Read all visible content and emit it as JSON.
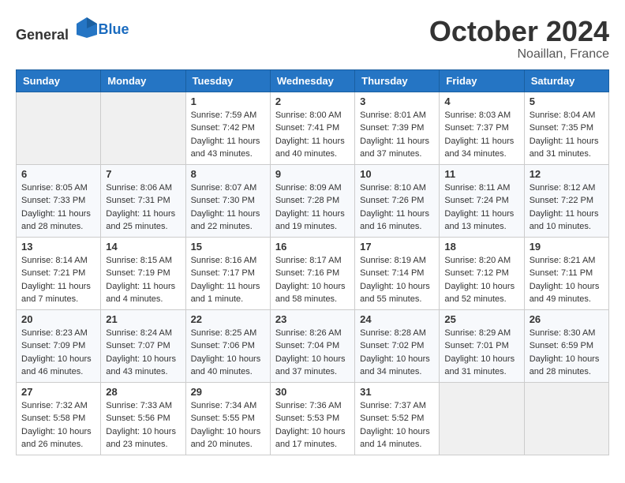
{
  "header": {
    "logo_general": "General",
    "logo_blue": "Blue",
    "month": "October 2024",
    "location": "Noaillan, France"
  },
  "days_of_week": [
    "Sunday",
    "Monday",
    "Tuesday",
    "Wednesday",
    "Thursday",
    "Friday",
    "Saturday"
  ],
  "weeks": [
    [
      {
        "day": "",
        "content": ""
      },
      {
        "day": "",
        "content": ""
      },
      {
        "day": "1",
        "content": "Sunrise: 7:59 AM\nSunset: 7:42 PM\nDaylight: 11 hours and 43 minutes."
      },
      {
        "day": "2",
        "content": "Sunrise: 8:00 AM\nSunset: 7:41 PM\nDaylight: 11 hours and 40 minutes."
      },
      {
        "day": "3",
        "content": "Sunrise: 8:01 AM\nSunset: 7:39 PM\nDaylight: 11 hours and 37 minutes."
      },
      {
        "day": "4",
        "content": "Sunrise: 8:03 AM\nSunset: 7:37 PM\nDaylight: 11 hours and 34 minutes."
      },
      {
        "day": "5",
        "content": "Sunrise: 8:04 AM\nSunset: 7:35 PM\nDaylight: 11 hours and 31 minutes."
      }
    ],
    [
      {
        "day": "6",
        "content": "Sunrise: 8:05 AM\nSunset: 7:33 PM\nDaylight: 11 hours and 28 minutes."
      },
      {
        "day": "7",
        "content": "Sunrise: 8:06 AM\nSunset: 7:31 PM\nDaylight: 11 hours and 25 minutes."
      },
      {
        "day": "8",
        "content": "Sunrise: 8:07 AM\nSunset: 7:30 PM\nDaylight: 11 hours and 22 minutes."
      },
      {
        "day": "9",
        "content": "Sunrise: 8:09 AM\nSunset: 7:28 PM\nDaylight: 11 hours and 19 minutes."
      },
      {
        "day": "10",
        "content": "Sunrise: 8:10 AM\nSunset: 7:26 PM\nDaylight: 11 hours and 16 minutes."
      },
      {
        "day": "11",
        "content": "Sunrise: 8:11 AM\nSunset: 7:24 PM\nDaylight: 11 hours and 13 minutes."
      },
      {
        "day": "12",
        "content": "Sunrise: 8:12 AM\nSunset: 7:22 PM\nDaylight: 11 hours and 10 minutes."
      }
    ],
    [
      {
        "day": "13",
        "content": "Sunrise: 8:14 AM\nSunset: 7:21 PM\nDaylight: 11 hours and 7 minutes."
      },
      {
        "day": "14",
        "content": "Sunrise: 8:15 AM\nSunset: 7:19 PM\nDaylight: 11 hours and 4 minutes."
      },
      {
        "day": "15",
        "content": "Sunrise: 8:16 AM\nSunset: 7:17 PM\nDaylight: 11 hours and 1 minute."
      },
      {
        "day": "16",
        "content": "Sunrise: 8:17 AM\nSunset: 7:16 PM\nDaylight: 10 hours and 58 minutes."
      },
      {
        "day": "17",
        "content": "Sunrise: 8:19 AM\nSunset: 7:14 PM\nDaylight: 10 hours and 55 minutes."
      },
      {
        "day": "18",
        "content": "Sunrise: 8:20 AM\nSunset: 7:12 PM\nDaylight: 10 hours and 52 minutes."
      },
      {
        "day": "19",
        "content": "Sunrise: 8:21 AM\nSunset: 7:11 PM\nDaylight: 10 hours and 49 minutes."
      }
    ],
    [
      {
        "day": "20",
        "content": "Sunrise: 8:23 AM\nSunset: 7:09 PM\nDaylight: 10 hours and 46 minutes."
      },
      {
        "day": "21",
        "content": "Sunrise: 8:24 AM\nSunset: 7:07 PM\nDaylight: 10 hours and 43 minutes."
      },
      {
        "day": "22",
        "content": "Sunrise: 8:25 AM\nSunset: 7:06 PM\nDaylight: 10 hours and 40 minutes."
      },
      {
        "day": "23",
        "content": "Sunrise: 8:26 AM\nSunset: 7:04 PM\nDaylight: 10 hours and 37 minutes."
      },
      {
        "day": "24",
        "content": "Sunrise: 8:28 AM\nSunset: 7:02 PM\nDaylight: 10 hours and 34 minutes."
      },
      {
        "day": "25",
        "content": "Sunrise: 8:29 AM\nSunset: 7:01 PM\nDaylight: 10 hours and 31 minutes."
      },
      {
        "day": "26",
        "content": "Sunrise: 8:30 AM\nSunset: 6:59 PM\nDaylight: 10 hours and 28 minutes."
      }
    ],
    [
      {
        "day": "27",
        "content": "Sunrise: 7:32 AM\nSunset: 5:58 PM\nDaylight: 10 hours and 26 minutes."
      },
      {
        "day": "28",
        "content": "Sunrise: 7:33 AM\nSunset: 5:56 PM\nDaylight: 10 hours and 23 minutes."
      },
      {
        "day": "29",
        "content": "Sunrise: 7:34 AM\nSunset: 5:55 PM\nDaylight: 10 hours and 20 minutes."
      },
      {
        "day": "30",
        "content": "Sunrise: 7:36 AM\nSunset: 5:53 PM\nDaylight: 10 hours and 17 minutes."
      },
      {
        "day": "31",
        "content": "Sunrise: 7:37 AM\nSunset: 5:52 PM\nDaylight: 10 hours and 14 minutes."
      },
      {
        "day": "",
        "content": ""
      },
      {
        "day": "",
        "content": ""
      }
    ]
  ]
}
